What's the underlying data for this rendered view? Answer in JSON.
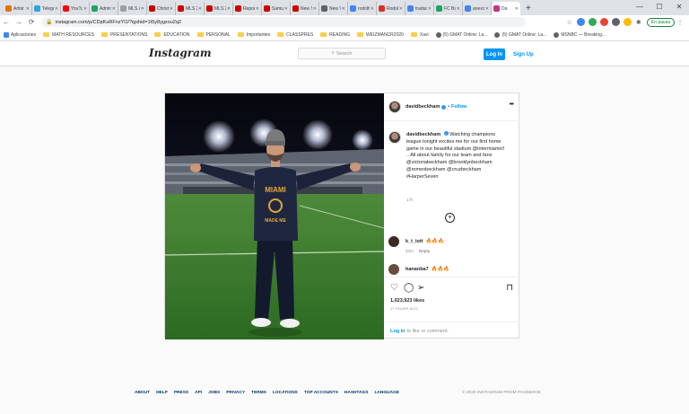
{
  "browser": {
    "tabs": [
      {
        "label": "Artist",
        "color": "#e8710a"
      },
      {
        "label": "Telegra",
        "color": "#2ca5e0"
      },
      {
        "label": "YouTub",
        "color": "#ff0000"
      },
      {
        "label": "Admin",
        "color": "#1da462"
      },
      {
        "label": "MLS ar",
        "color": "#9aa0a6"
      },
      {
        "label": "Christi",
        "color": "#cc0000"
      },
      {
        "label": "MLS 20",
        "color": "#cc0000"
      },
      {
        "label": "MLS 20",
        "color": "#cc0000"
      },
      {
        "label": "Report",
        "color": "#cc0000"
      },
      {
        "label": "Samuel",
        "color": "#cc0000"
      },
      {
        "label": "New Yo",
        "color": "#cc0000"
      },
      {
        "label": "New Yo",
        "color": "#5f6368"
      },
      {
        "label": "rodolfo",
        "color": "#4285f4"
      },
      {
        "label": "Rodolfo",
        "color": "#d93025"
      },
      {
        "label": "traduct",
        "color": "#4285f4"
      },
      {
        "label": "FC Baye",
        "color": "#1da462"
      },
      {
        "label": "anexo",
        "color": "#4285f4"
      },
      {
        "label": "Da",
        "color": "#c13584"
      }
    ],
    "new_tab": "+",
    "window_controls": {
      "minimize": "—",
      "maximize": "☐",
      "close": "✕"
    },
    "url": "instagram.com/p/CDpKuRFnzYO/?igshid=1t5y8ygzou2q2",
    "profile_label": "En pausa",
    "bookmarks": [
      {
        "label": "Aplicaciones",
        "kind": "apps"
      },
      {
        "label": "MATH RESOURCES",
        "kind": "folder"
      },
      {
        "label": "PRESENTATIONS",
        "kind": "folder"
      },
      {
        "label": "EDUCATION",
        "kind": "folder"
      },
      {
        "label": "PERSONAL",
        "kind": "folder"
      },
      {
        "label": "Importantes",
        "kind": "folder"
      },
      {
        "label": "CLASSPRES",
        "kind": "folder"
      },
      {
        "label": "READING",
        "kind": "folder"
      },
      {
        "label": "WEIZMANCR2020",
        "kind": "folder"
      },
      {
        "label": "Xavi",
        "kind": "folder"
      },
      {
        "label": "(5) GMAT Online: La...",
        "kind": "site"
      },
      {
        "label": "(5) GMAT Online: La...",
        "kind": "site"
      },
      {
        "label": "MSNBC — Breaking...",
        "kind": "site"
      }
    ]
  },
  "header": {
    "logo": "Instagram",
    "search_placeholder": "Search",
    "login_label": "Log In",
    "signup_label": "Sign Up"
  },
  "post": {
    "photo": {
      "shirt_text_top": "MIAMI",
      "shirt_text_bottom": "MADE ME"
    },
    "author": "davidbeckham",
    "dot": "•",
    "follow_label": "Follow",
    "more": "•••",
    "caption_author": "davidbeckham",
    "caption_text": "Watching champions league tonight excites me for our first home game in our beautiful stadium @intermiamicf .. All about family for our team and fans @victoriabeckham @brooklynbeckham @romeobeckham @cruzbeckham #HarperSeven",
    "caption_age": "17h",
    "load_more": "+",
    "comments": [
      {
        "user": "k_t_iott",
        "text": "🔥🔥🔥",
        "age": "33m",
        "reply": "Reply",
        "avatar": "#3a2a22"
      },
      {
        "user": "hananba7",
        "text": "🔥🔥🔥",
        "age": "",
        "reply": "",
        "avatar": "#6a4c3a"
      }
    ],
    "likes": "1,023,923 likes",
    "posted": "17 HOURS AGO",
    "login_link": "Log in",
    "login_suffix": "to like or comment."
  },
  "footer": {
    "links": [
      "ABOUT",
      "HELP",
      "PRESS",
      "API",
      "JOBS",
      "PRIVACY",
      "TERMS",
      "LOCATIONS",
      "TOP ACCOUNTS",
      "HASHTAGS",
      "LANGUAGE"
    ],
    "copyright": "© 2020 INSTAGRAM FROM FACEBOOK"
  }
}
